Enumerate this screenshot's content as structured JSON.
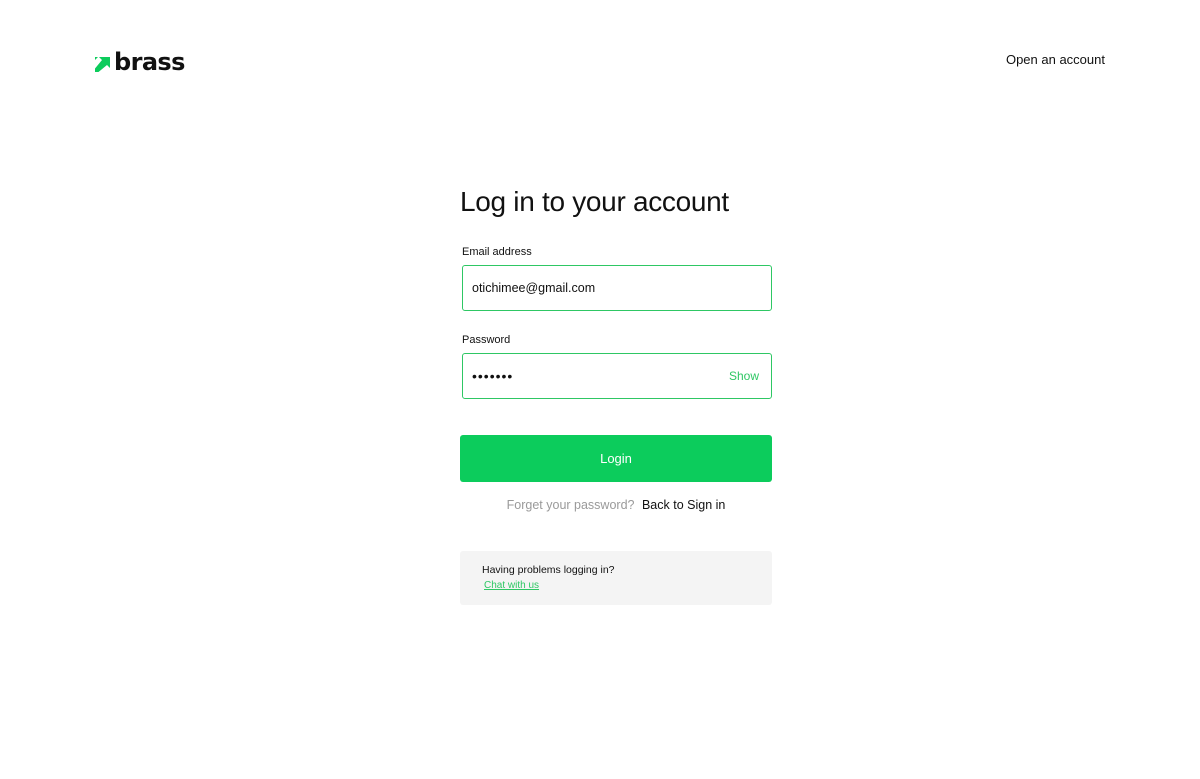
{
  "brand": {
    "name": "brass",
    "logo_icon": "arrow-up-right-icon",
    "accent_color": "#0ccc5c"
  },
  "header": {
    "open_account_label": "Open an account"
  },
  "form": {
    "title": "Log in to your account",
    "email": {
      "label": "Email address",
      "value": "otichimee@gmail.com"
    },
    "password": {
      "label": "Password",
      "value": "•••••••",
      "toggle_label": "Show"
    },
    "login_label": "Login",
    "forgot_label": "Forget your password?",
    "back_label": "Back to Sign in"
  },
  "help": {
    "title": "Having problems logging in?",
    "link_label": "Chat with us"
  }
}
